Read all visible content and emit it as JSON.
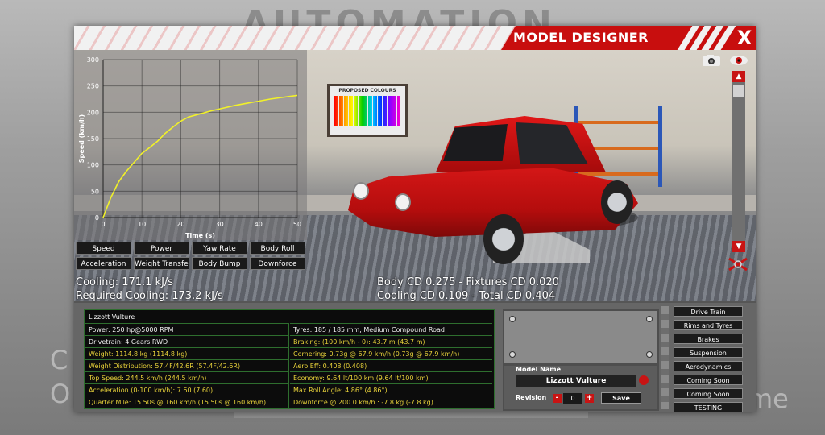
{
  "background": {
    "logo_text": "AUTOMATION",
    "left_text_1": "C",
    "left_text_2": "O",
    "right_text": "me"
  },
  "window": {
    "title": "MODEL DESIGNER",
    "close_label": "X"
  },
  "viewport": {
    "poster_title": "PROPOSED COLOURS"
  },
  "chart_data": {
    "type": "line",
    "xlabel": "Time (s)",
    "ylabel": "Speed (km/h)",
    "xlim": [
      0,
      50
    ],
    "ylim": [
      0,
      300
    ],
    "x_ticks": [
      "0",
      "10",
      "20",
      "30",
      "40",
      "50"
    ],
    "y_ticks": [
      "0",
      "50",
      "100",
      "150",
      "200",
      "250",
      "300"
    ],
    "grid": true,
    "series": [
      {
        "x": [
          0,
          2,
          4,
          6,
          8,
          10,
          12,
          14,
          16,
          18,
          20,
          22,
          25,
          28,
          31,
          34,
          37,
          40,
          43,
          46,
          48,
          50
        ],
        "y": [
          0,
          38,
          68,
          88,
          105,
          122,
          133,
          145,
          160,
          172,
          183,
          191,
          197,
          203,
          208,
          213,
          217,
          221,
          225,
          228,
          230,
          232
        ]
      }
    ],
    "line_color": "#f1f129"
  },
  "graph_buttons": [
    "Speed",
    "Power",
    "Yaw Rate",
    "Body Roll",
    "Acceleration",
    "Weight Transfer",
    "Body Bump",
    "Downforce"
  ],
  "readouts": {
    "cooling": "Cooling: 171.1 kJ/s",
    "required_cooling": "Required Cooling: 173.2 kJ/s",
    "cd_line1": "Body CD 0.275 - Fixtures CD 0.020",
    "cd_line2": "Cooling CD 0.109 - Total CD 0.404"
  },
  "stats": {
    "model": "Lizzott Vulture",
    "left": [
      {
        "text": "Power: 250 hp@5000 RPM",
        "color": "white"
      },
      {
        "text": "Drivetrain: 4 Gears RWD",
        "color": "white"
      },
      {
        "text": "Weight: 1114.8 kg (1114.8 kg)",
        "color": "yellow"
      },
      {
        "text": "Weight Distribution: 57.4F/42.6R (57.4F/42.6R)",
        "color": "yellow"
      },
      {
        "text": "Top Speed: 244.5 km/h (244.5 km/h)",
        "color": "yellow"
      },
      {
        "text": "Acceleration (0-100 km/h): 7.60 (7.60)",
        "color": "yellow"
      },
      {
        "text": "Quarter Mile: 15.50s @ 160 km/h (15.50s @ 160 km/h)",
        "color": "yellow"
      }
    ],
    "right": [
      {
        "text": "Tyres: 185 / 185 mm, Medium Compound Road",
        "color": "white"
      },
      {
        "text": "Braking: (100 km/h - 0): 43.7 m (43.7 m)",
        "color": "yellow"
      },
      {
        "text": "Cornering: 0.73g @ 67.9 km/h (0.73g @ 67.9 km/h)",
        "color": "yellow"
      },
      {
        "text": "Aero Eff: 0.408 (0.408)",
        "color": "yellow"
      },
      {
        "text": "Economy: 9.64 lt/100 km (9.64 lt/100 km)",
        "color": "yellow"
      },
      {
        "text": "Max Roll Angle: 4.86° (4.86°)",
        "color": "yellow"
      },
      {
        "text": "Downforce @ 200.0 km/h : -7.8 kg (-7.8 kg)",
        "color": "yellow"
      }
    ]
  },
  "model_panel": {
    "label": "Model Name",
    "name": "Lizzott Vulture",
    "revision_label": "Revision",
    "revision": "0",
    "save_label": "Save",
    "minus": "-",
    "plus": "+"
  },
  "nav": [
    "Drive Train",
    "Rims and Tyres",
    "Brakes",
    "Suspension",
    "Aerodynamics",
    "Coming Soon",
    "Coming Soon",
    "TESTING"
  ],
  "scrollbar": {
    "up": "▲",
    "down": "▼"
  },
  "colors": {
    "accent_red": "#c80e0e",
    "stat_yellow": "#e8d23a",
    "grid_green": "#2e6e2e"
  }
}
